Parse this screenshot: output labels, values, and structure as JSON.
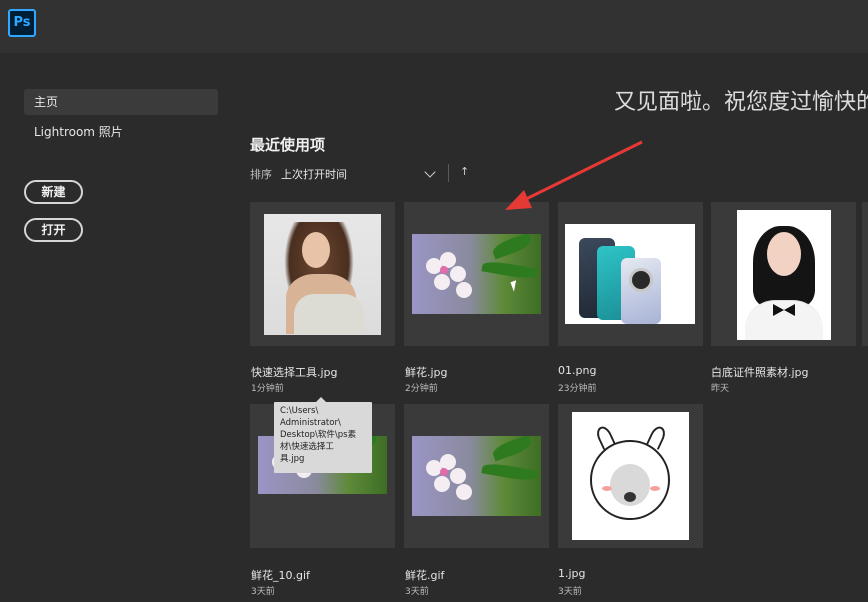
{
  "app": {
    "logo": "Ps",
    "accent": "#31a8ff"
  },
  "sidebar": {
    "items": [
      {
        "label": "主页",
        "active": true
      },
      {
        "label": "Lightroom 照片",
        "active": false
      }
    ],
    "buttons": {
      "new_label": "新建",
      "open_label": "打开"
    }
  },
  "header": {
    "greeting": "又见面啦。祝您度过愉快的"
  },
  "recent": {
    "title": "最近使用项",
    "sort_label": "排序",
    "sort_value": "上次打开时间",
    "sort_direction_icon": "↑",
    "items": [
      {
        "name": "快速选择工具.jpg",
        "time": "1分钟前",
        "thumb": "portrait-woman"
      },
      {
        "name": "鲜花.jpg",
        "time": "2分钟前",
        "thumb": "flower"
      },
      {
        "name": "01.png",
        "time": "23分钟前",
        "thumb": "phones"
      },
      {
        "name": "白底证件照素材.jpg",
        "time": "昨天",
        "thumb": "id-photo"
      },
      {
        "name": "鲜花_10.gif",
        "time": "3天前",
        "thumb": "flower"
      },
      {
        "name": "鲜花.gif",
        "time": "3天前",
        "thumb": "flower"
      },
      {
        "name": "1.jpg",
        "time": "3天前",
        "thumb": "meme"
      }
    ]
  },
  "tooltip": {
    "lines": [
      "C:\\Users\\",
      "Administrator\\",
      "Desktop\\软件\\ps素",
      "材\\快速选择工",
      "具.jpg"
    ]
  },
  "annotation": {
    "arrow_color": "#e53935"
  }
}
